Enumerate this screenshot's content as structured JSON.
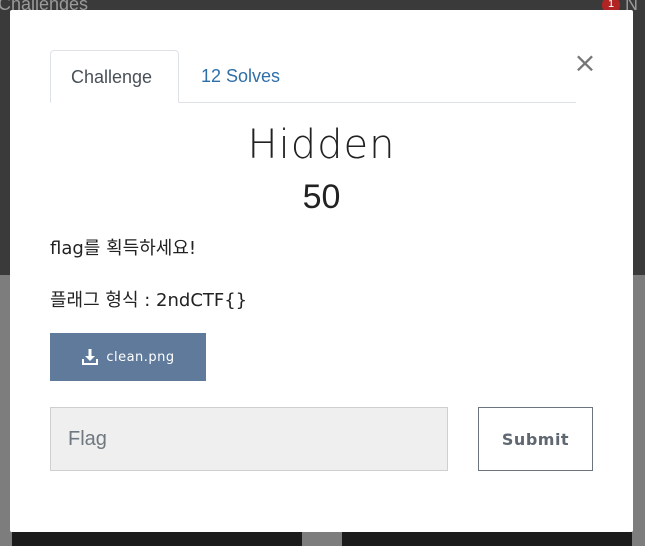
{
  "background": {
    "header_title": "Challenges",
    "badge_count": "1",
    "header_right": "N"
  },
  "modal": {
    "close_label": "×",
    "tabs": [
      {
        "label": "Challenge",
        "active": true
      },
      {
        "label": "12 Solves",
        "active": false
      }
    ],
    "challenge": {
      "name": "Hidden",
      "points": "50",
      "description_lines": [
        "flag를 획득하세요!",
        "플래그 형식 : 2ndCTF{}"
      ],
      "file_button": {
        "icon": "download-icon",
        "label": "clean.png"
      }
    },
    "flag_input": {
      "placeholder": "Flag",
      "value": ""
    },
    "submit_label": "Submit"
  },
  "colors": {
    "accent_link": "#2f6fa8",
    "download_button": "#5f7a9a",
    "input_bg": "#efefef"
  }
}
